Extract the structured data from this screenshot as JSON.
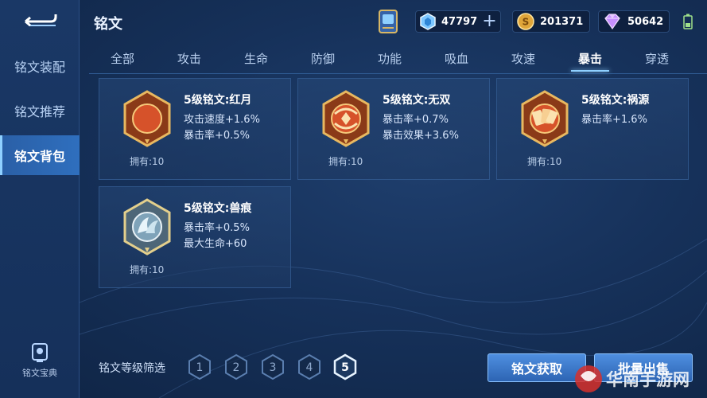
{
  "sidebar": {
    "items": [
      {
        "label": "铭文装配"
      },
      {
        "label": "铭文推荐"
      },
      {
        "label": "铭文背包"
      }
    ],
    "codex_label": "铭文宝典"
  },
  "header": {
    "title": "铭文",
    "currencies": [
      {
        "icon": "diamond-coupon-icon",
        "value": "47797"
      },
      {
        "icon": "gold-coin-icon",
        "value": "201371"
      },
      {
        "icon": "gem-icon",
        "value": "50642"
      }
    ]
  },
  "tabs": [
    {
      "label": "全部"
    },
    {
      "label": "攻击"
    },
    {
      "label": "生命"
    },
    {
      "label": "防御"
    },
    {
      "label": "功能"
    },
    {
      "label": "吸血"
    },
    {
      "label": "攻速"
    },
    {
      "label": "暴击"
    },
    {
      "label": "穿透"
    }
  ],
  "active_tab": "暴击",
  "inscriptions": [
    {
      "name": "5级铭文:红月",
      "stats": [
        "攻击速度+1.6%",
        "暴击率+0.5%"
      ],
      "owned": "拥有:10",
      "icon": "red-moon-icon",
      "color": "#c9502a"
    },
    {
      "name": "5级铭文:无双",
      "stats": [
        "暴击率+0.7%",
        "暴击效果+3.6%"
      ],
      "owned": "拥有:10",
      "icon": "unrivaled-icon",
      "color": "#c9502a"
    },
    {
      "name": "5级铭文:祸源",
      "stats": [
        "暴击率+1.6%"
      ],
      "owned": "拥有:10",
      "icon": "calamity-icon",
      "color": "#c9502a"
    },
    {
      "name": "5级铭文:兽痕",
      "stats": [
        "暴击率+0.5%",
        "最大生命+60"
      ],
      "owned": "拥有:10",
      "icon": "beast-mark-icon",
      "color": "#8fb3c9"
    }
  ],
  "filter": {
    "label": "铭文等级筛选",
    "levels": [
      "1",
      "2",
      "3",
      "4",
      "5"
    ],
    "selected": "5"
  },
  "buttons": {
    "obtain": "铭文获取",
    "bulk_sell": "批量出售"
  },
  "watermark": "华南手游网"
}
